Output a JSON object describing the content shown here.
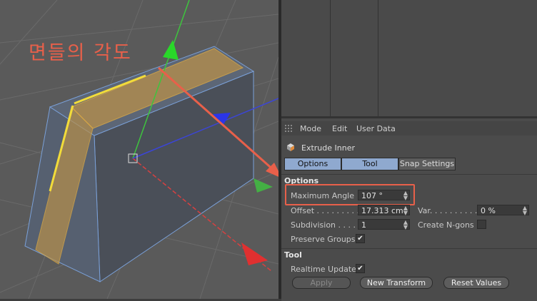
{
  "annotation": {
    "text": "면들의 각도"
  },
  "menu": {
    "mode": "Mode",
    "edit": "Edit",
    "user_data": "User Data"
  },
  "object": {
    "title": "Extrude Inner"
  },
  "tabs": {
    "options": "Options",
    "tool": "Tool",
    "snap": "Snap Settings"
  },
  "options": {
    "heading": "Options",
    "max_angle_label": "Maximum Angle",
    "max_angle_value": "107 °",
    "offset_label": "Offset . . . . . . . . .",
    "offset_value": "17.313 cm",
    "var_label": "Var. . . . . . . . . . .",
    "var_value": "0 %",
    "subdivision_label": "Subdivision . . . .",
    "subdivision_value": "1",
    "create_ngons_label": "Create N-gons",
    "preserve_groups_label": "Preserve Groups"
  },
  "tool": {
    "heading": "Tool",
    "realtime_label": "Realtime Update",
    "apply": "Apply",
    "new_transform": "New Transform",
    "reset_values": "Reset Values"
  },
  "colors": {
    "accent": "#e8604a",
    "tab_active": "#8fa9cf",
    "selection": "#e8b040"
  }
}
